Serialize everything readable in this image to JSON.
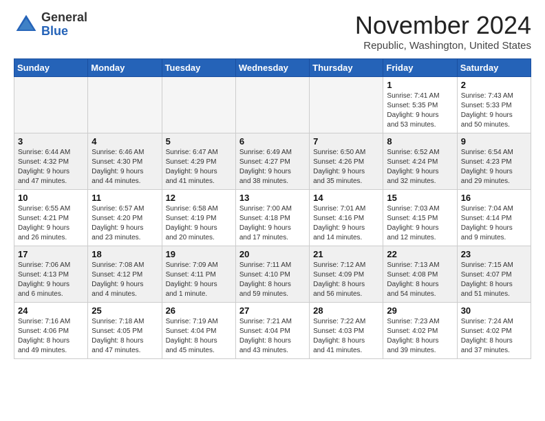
{
  "logo": {
    "general": "General",
    "blue": "Blue"
  },
  "title": "November 2024",
  "location": "Republic, Washington, United States",
  "header_days": [
    "Sunday",
    "Monday",
    "Tuesday",
    "Wednesday",
    "Thursday",
    "Friday",
    "Saturday"
  ],
  "weeks": [
    {
      "style": "normal",
      "days": [
        {
          "num": "",
          "info": ""
        },
        {
          "num": "",
          "info": ""
        },
        {
          "num": "",
          "info": ""
        },
        {
          "num": "",
          "info": ""
        },
        {
          "num": "",
          "info": ""
        },
        {
          "num": "1",
          "info": "Sunrise: 7:41 AM\nSunset: 5:35 PM\nDaylight: 9 hours\nand 53 minutes."
        },
        {
          "num": "2",
          "info": "Sunrise: 7:43 AM\nSunset: 5:33 PM\nDaylight: 9 hours\nand 50 minutes."
        }
      ]
    },
    {
      "style": "gray",
      "days": [
        {
          "num": "3",
          "info": "Sunrise: 6:44 AM\nSunset: 4:32 PM\nDaylight: 9 hours\nand 47 minutes."
        },
        {
          "num": "4",
          "info": "Sunrise: 6:46 AM\nSunset: 4:30 PM\nDaylight: 9 hours\nand 44 minutes."
        },
        {
          "num": "5",
          "info": "Sunrise: 6:47 AM\nSunset: 4:29 PM\nDaylight: 9 hours\nand 41 minutes."
        },
        {
          "num": "6",
          "info": "Sunrise: 6:49 AM\nSunset: 4:27 PM\nDaylight: 9 hours\nand 38 minutes."
        },
        {
          "num": "7",
          "info": "Sunrise: 6:50 AM\nSunset: 4:26 PM\nDaylight: 9 hours\nand 35 minutes."
        },
        {
          "num": "8",
          "info": "Sunrise: 6:52 AM\nSunset: 4:24 PM\nDaylight: 9 hours\nand 32 minutes."
        },
        {
          "num": "9",
          "info": "Sunrise: 6:54 AM\nSunset: 4:23 PM\nDaylight: 9 hours\nand 29 minutes."
        }
      ]
    },
    {
      "style": "normal",
      "days": [
        {
          "num": "10",
          "info": "Sunrise: 6:55 AM\nSunset: 4:21 PM\nDaylight: 9 hours\nand 26 minutes."
        },
        {
          "num": "11",
          "info": "Sunrise: 6:57 AM\nSunset: 4:20 PM\nDaylight: 9 hours\nand 23 minutes."
        },
        {
          "num": "12",
          "info": "Sunrise: 6:58 AM\nSunset: 4:19 PM\nDaylight: 9 hours\nand 20 minutes."
        },
        {
          "num": "13",
          "info": "Sunrise: 7:00 AM\nSunset: 4:18 PM\nDaylight: 9 hours\nand 17 minutes."
        },
        {
          "num": "14",
          "info": "Sunrise: 7:01 AM\nSunset: 4:16 PM\nDaylight: 9 hours\nand 14 minutes."
        },
        {
          "num": "15",
          "info": "Sunrise: 7:03 AM\nSunset: 4:15 PM\nDaylight: 9 hours\nand 12 minutes."
        },
        {
          "num": "16",
          "info": "Sunrise: 7:04 AM\nSunset: 4:14 PM\nDaylight: 9 hours\nand 9 minutes."
        }
      ]
    },
    {
      "style": "gray",
      "days": [
        {
          "num": "17",
          "info": "Sunrise: 7:06 AM\nSunset: 4:13 PM\nDaylight: 9 hours\nand 6 minutes."
        },
        {
          "num": "18",
          "info": "Sunrise: 7:08 AM\nSunset: 4:12 PM\nDaylight: 9 hours\nand 4 minutes."
        },
        {
          "num": "19",
          "info": "Sunrise: 7:09 AM\nSunset: 4:11 PM\nDaylight: 9 hours\nand 1 minute."
        },
        {
          "num": "20",
          "info": "Sunrise: 7:11 AM\nSunset: 4:10 PM\nDaylight: 8 hours\nand 59 minutes."
        },
        {
          "num": "21",
          "info": "Sunrise: 7:12 AM\nSunset: 4:09 PM\nDaylight: 8 hours\nand 56 minutes."
        },
        {
          "num": "22",
          "info": "Sunrise: 7:13 AM\nSunset: 4:08 PM\nDaylight: 8 hours\nand 54 minutes."
        },
        {
          "num": "23",
          "info": "Sunrise: 7:15 AM\nSunset: 4:07 PM\nDaylight: 8 hours\nand 51 minutes."
        }
      ]
    },
    {
      "style": "normal",
      "days": [
        {
          "num": "24",
          "info": "Sunrise: 7:16 AM\nSunset: 4:06 PM\nDaylight: 8 hours\nand 49 minutes."
        },
        {
          "num": "25",
          "info": "Sunrise: 7:18 AM\nSunset: 4:05 PM\nDaylight: 8 hours\nand 47 minutes."
        },
        {
          "num": "26",
          "info": "Sunrise: 7:19 AM\nSunset: 4:04 PM\nDaylight: 8 hours\nand 45 minutes."
        },
        {
          "num": "27",
          "info": "Sunrise: 7:21 AM\nSunset: 4:04 PM\nDaylight: 8 hours\nand 43 minutes."
        },
        {
          "num": "28",
          "info": "Sunrise: 7:22 AM\nSunset: 4:03 PM\nDaylight: 8 hours\nand 41 minutes."
        },
        {
          "num": "29",
          "info": "Sunrise: 7:23 AM\nSunset: 4:02 PM\nDaylight: 8 hours\nand 39 minutes."
        },
        {
          "num": "30",
          "info": "Sunrise: 7:24 AM\nSunset: 4:02 PM\nDaylight: 8 hours\nand 37 minutes."
        }
      ]
    }
  ]
}
